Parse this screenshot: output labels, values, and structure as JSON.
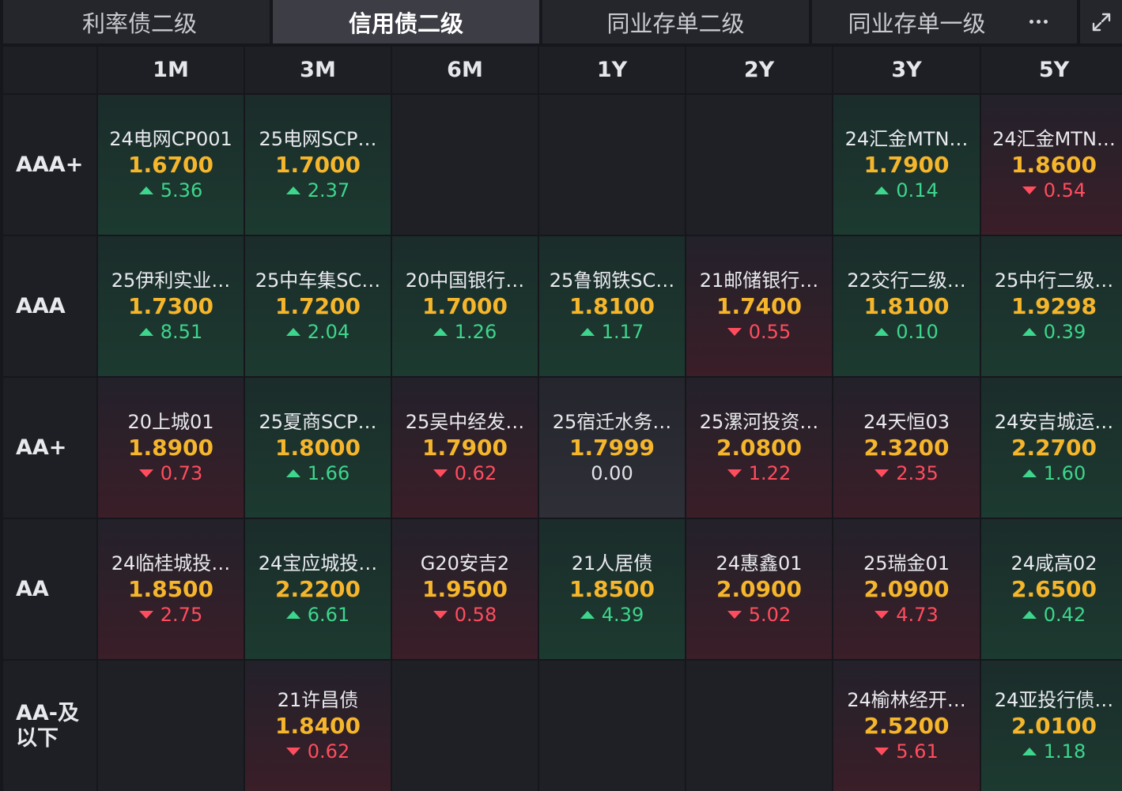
{
  "tabs": [
    {
      "label": "利率债二级",
      "active": false
    },
    {
      "label": "信用债二级",
      "active": true
    },
    {
      "label": "同业存单二级",
      "active": false
    },
    {
      "label": "同业存单一级",
      "active": false
    }
  ],
  "more_icon": "more-dots-icon",
  "expand_icon": "expand-icon",
  "columns": [
    "1M",
    "3M",
    "6M",
    "1Y",
    "2Y",
    "3Y",
    "5Y"
  ],
  "colors": {
    "up": "#3dd68c",
    "down": "#ff4d5e",
    "yield": "#f5b62c"
  },
  "rows": [
    {
      "label": "AAA+",
      "cells": [
        {
          "name": "24电网CP001",
          "yield": "1.6700",
          "change": "5.36",
          "dir": "up"
        },
        {
          "name": "25电网SCP…",
          "yield": "1.7000",
          "change": "2.37",
          "dir": "up"
        },
        null,
        null,
        null,
        {
          "name": "24汇金MTN…",
          "yield": "1.7900",
          "change": "0.14",
          "dir": "up"
        },
        {
          "name": "24汇金MTN…",
          "yield": "1.8600",
          "change": "0.54",
          "dir": "down"
        }
      ]
    },
    {
      "label": "AAA",
      "cells": [
        {
          "name": "25伊利实业…",
          "yield": "1.7300",
          "change": "8.51",
          "dir": "up"
        },
        {
          "name": "25中车集SC…",
          "yield": "1.7200",
          "change": "2.04",
          "dir": "up"
        },
        {
          "name": "20中国银行…",
          "yield": "1.7000",
          "change": "1.26",
          "dir": "up"
        },
        {
          "name": "25鲁钢铁SC…",
          "yield": "1.8100",
          "change": "1.17",
          "dir": "up"
        },
        {
          "name": "21邮储银行…",
          "yield": "1.7400",
          "change": "0.55",
          "dir": "down"
        },
        {
          "name": "22交行二级…",
          "yield": "1.8100",
          "change": "0.10",
          "dir": "up"
        },
        {
          "name": "25中行二级…",
          "yield": "1.9298",
          "change": "0.39",
          "dir": "up"
        }
      ]
    },
    {
      "label": "AA+",
      "cells": [
        {
          "name": "20上城01",
          "yield": "1.8900",
          "change": "0.73",
          "dir": "down"
        },
        {
          "name": "25夏商SCP…",
          "yield": "1.8000",
          "change": "1.66",
          "dir": "up"
        },
        {
          "name": "25吴中经发…",
          "yield": "1.7900",
          "change": "0.62",
          "dir": "down"
        },
        {
          "name": "25宿迁水务…",
          "yield": "1.7999",
          "change": "0.00",
          "dir": "flat"
        },
        {
          "name": "25漯河投资…",
          "yield": "2.0800",
          "change": "1.22",
          "dir": "down"
        },
        {
          "name": "24天恒03",
          "yield": "2.3200",
          "change": "2.35",
          "dir": "down"
        },
        {
          "name": "24安吉城运…",
          "yield": "2.2700",
          "change": "1.60",
          "dir": "up"
        }
      ]
    },
    {
      "label": "AA",
      "cells": [
        {
          "name": "24临桂城投…",
          "yield": "1.8500",
          "change": "2.75",
          "dir": "down"
        },
        {
          "name": "24宝应城投…",
          "yield": "2.2200",
          "change": "6.61",
          "dir": "up"
        },
        {
          "name": "G20安吉2",
          "yield": "1.9500",
          "change": "0.58",
          "dir": "down"
        },
        {
          "name": "21人居债",
          "yield": "1.8500",
          "change": "4.39",
          "dir": "up"
        },
        {
          "name": "24惠鑫01",
          "yield": "2.0900",
          "change": "5.02",
          "dir": "down"
        },
        {
          "name": "25瑞金01",
          "yield": "2.0900",
          "change": "4.73",
          "dir": "down"
        },
        {
          "name": "24咸高02",
          "yield": "2.6500",
          "change": "0.42",
          "dir": "up"
        }
      ]
    },
    {
      "label": "AA-及以下",
      "cells": [
        null,
        {
          "name": "21许昌债",
          "yield": "1.8400",
          "change": "0.62",
          "dir": "down"
        },
        null,
        null,
        null,
        {
          "name": "24榆林经开…",
          "yield": "2.5200",
          "change": "5.61",
          "dir": "down"
        },
        {
          "name": "24亚投行债…",
          "yield": "2.0100",
          "change": "1.18",
          "dir": "up"
        }
      ]
    }
  ]
}
